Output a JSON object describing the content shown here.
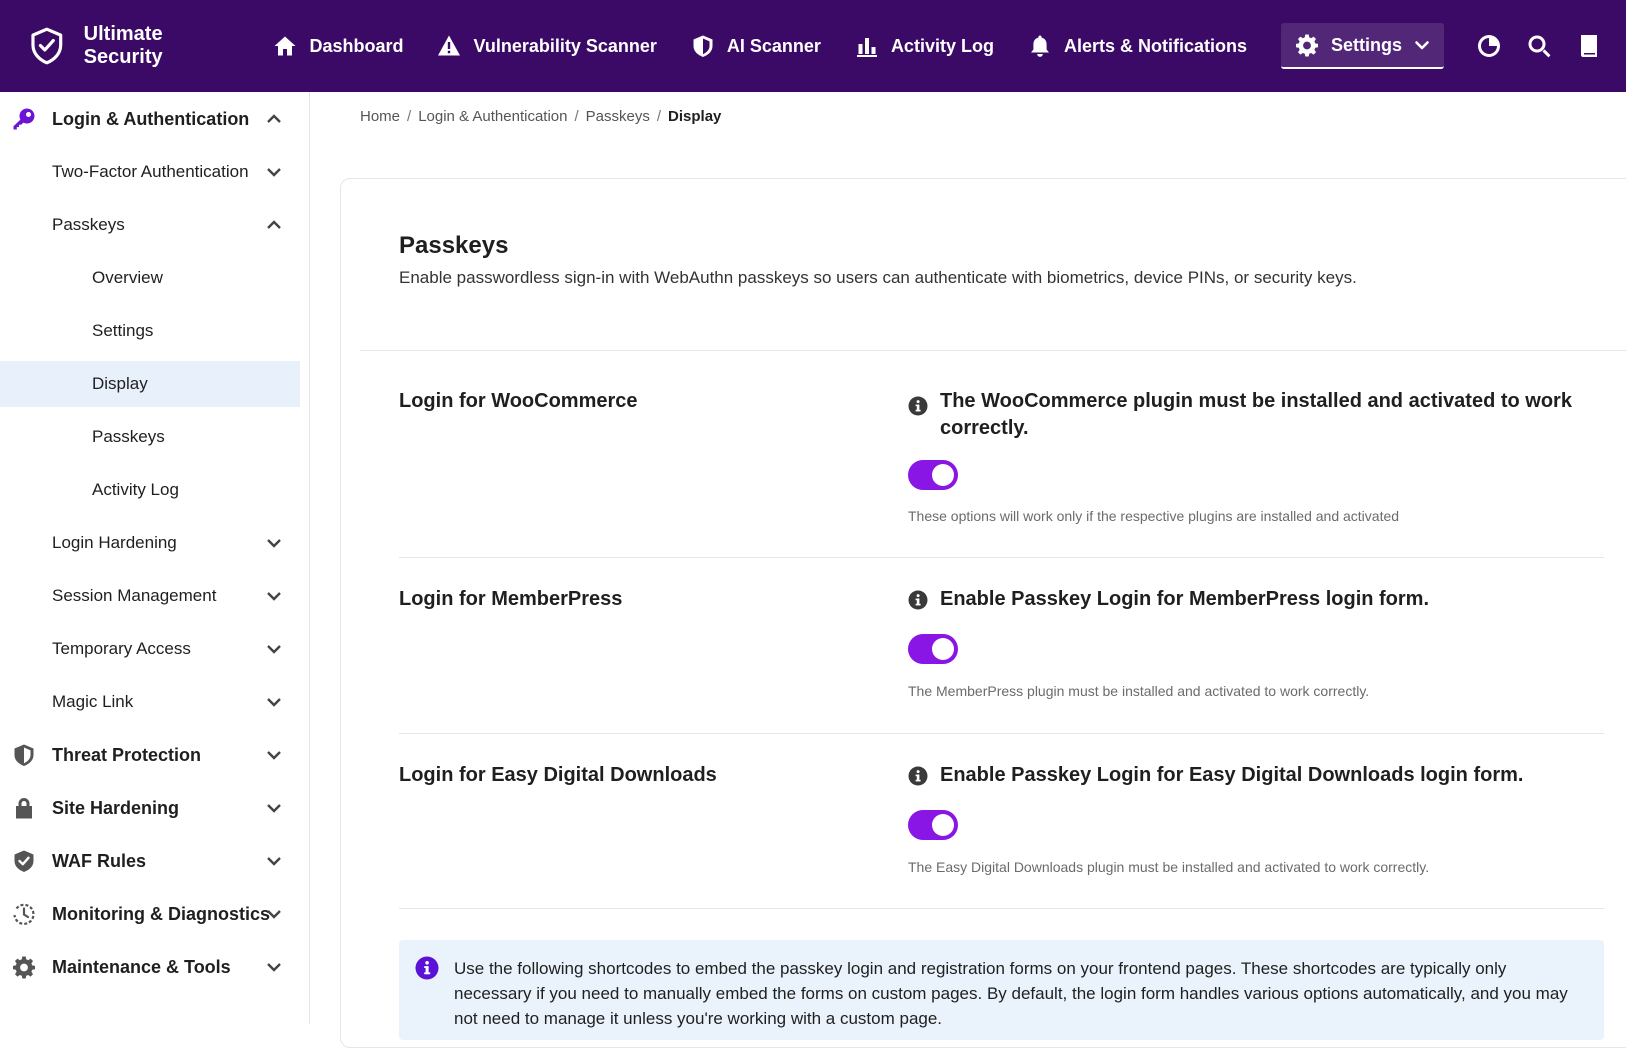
{
  "app": {
    "name": "Ultimate Security"
  },
  "nav": [
    {
      "label": "Dashboard",
      "icon": "home-icon"
    },
    {
      "label": "Vulnerability Scanner",
      "icon": "warning-icon"
    },
    {
      "label": "AI Scanner",
      "icon": "shield-icon"
    },
    {
      "label": "Activity Log",
      "icon": "bar-chart-icon"
    },
    {
      "label": "Alerts & Notifications",
      "icon": "bell-icon"
    },
    {
      "label": "Settings",
      "icon": "gear-icon"
    }
  ],
  "sidebar": {
    "items": [
      {
        "label": "Login & Authentication"
      },
      {
        "label": "Two-Factor Authentication"
      },
      {
        "label": "Passkeys"
      },
      {
        "label": "Overview"
      },
      {
        "label": "Settings"
      },
      {
        "label": "Display"
      },
      {
        "label": "Passkeys"
      },
      {
        "label": "Activity Log"
      },
      {
        "label": "Login Hardening"
      },
      {
        "label": "Session Management"
      },
      {
        "label": "Temporary Access"
      },
      {
        "label": "Magic Link"
      },
      {
        "label": "Threat Protection"
      },
      {
        "label": "Site Hardening"
      },
      {
        "label": "WAF Rules"
      },
      {
        "label": "Monitoring & Diagnostics"
      },
      {
        "label": "Maintenance & Tools"
      }
    ]
  },
  "breadcrumb": {
    "home": "Home",
    "section": "Login & Authentication",
    "parent": "Passkeys",
    "current": "Display",
    "separator": "/"
  },
  "page": {
    "title": "Passkeys",
    "subtitle": "Enable passwordless sign-in with WebAuthn passkeys so users can authenticate with biometrics, device PINs, or security keys."
  },
  "options": [
    {
      "label": "Login for WooCommerce",
      "heading": "The WooCommerce plugin must be installed and activated to work correctly.",
      "enabled": true,
      "hint": "These options will work only if the respective plugins are installed and activated"
    },
    {
      "label": "Login for MemberPress",
      "heading": "Enable Passkey Login for MemberPress login form.",
      "enabled": true,
      "hint": "The MemberPress plugin must be installed and activated to work correctly."
    },
    {
      "label": "Login for Easy Digital Downloads",
      "heading": "Enable Passkey Login for Easy Digital Downloads login form.",
      "enabled": true,
      "hint": "The Easy Digital Downloads plugin must be installed and activated to work correctly."
    }
  ],
  "notice": {
    "text": "Use the following shortcodes to embed the passkey login and registration forms on your frontend pages. These shortcodes are typically only necessary if you need to manually embed the forms on custom pages. By default, the login form handles various options automatically, and you may not need to manage it unless you're working with a custom page."
  },
  "colors": {
    "topbar": "#3b0a66",
    "accent": "#8a16e6",
    "sidebar_active": "#e8f1fb",
    "notice_bg": "#eaf3fc"
  }
}
